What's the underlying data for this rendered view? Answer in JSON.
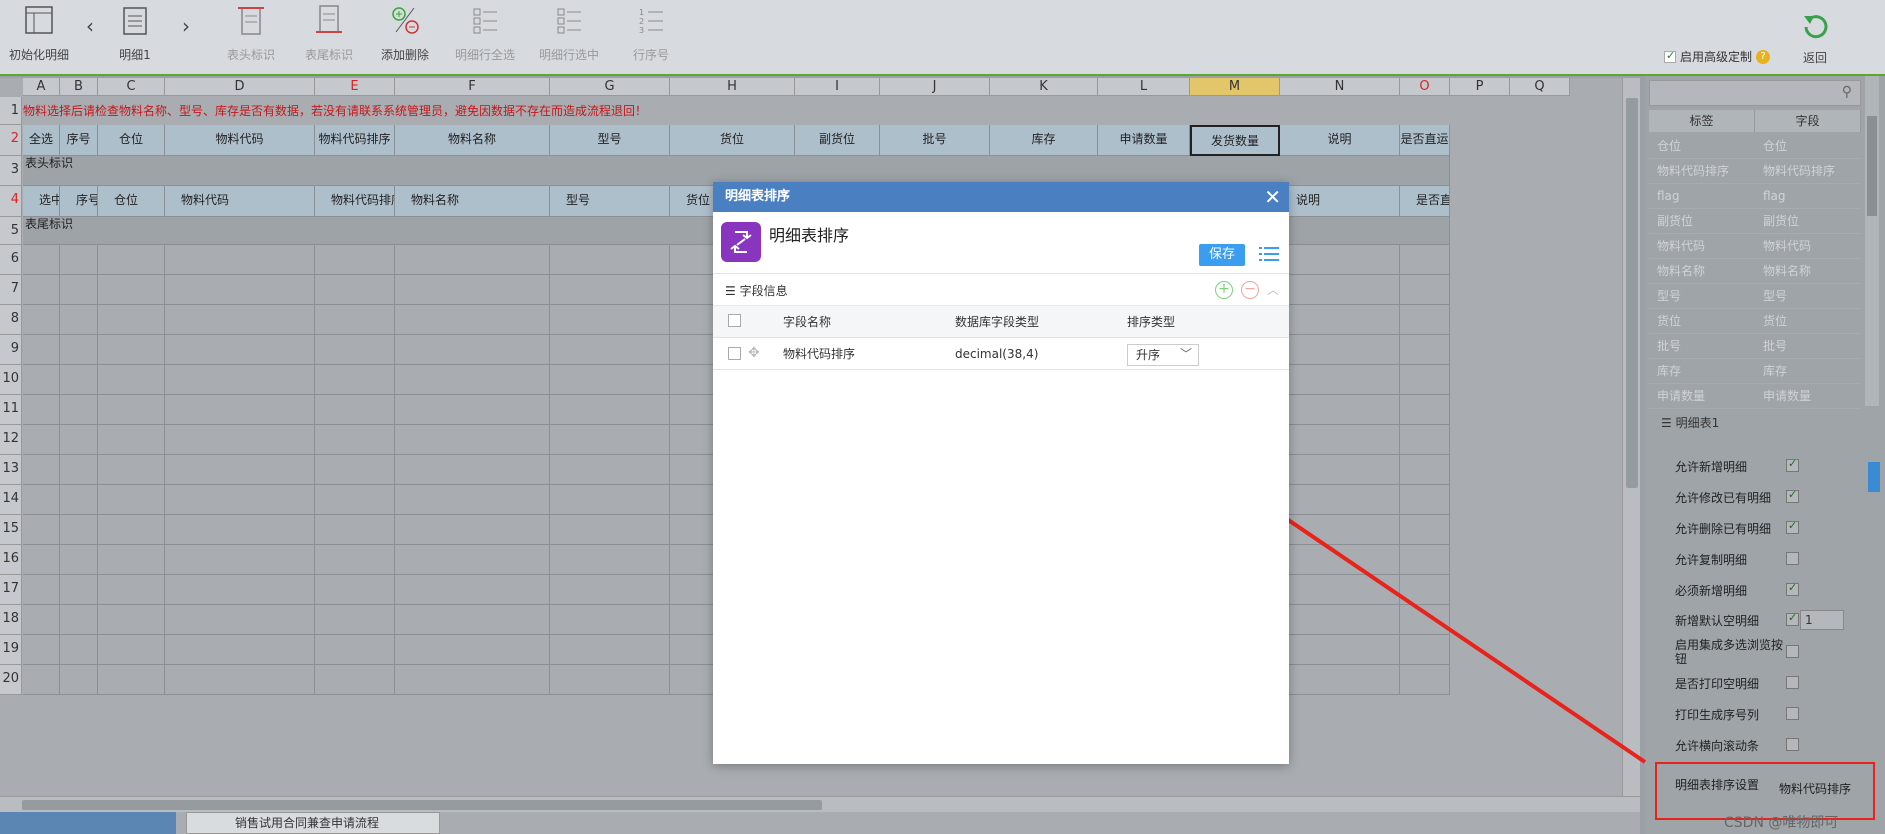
{
  "toolbar": {
    "init_label": "初始化明细",
    "prev_label": "‹",
    "detail_label": "明细1",
    "next_label": "›",
    "header_mark_label": "表头标识",
    "footer_mark_label": "表尾标识",
    "add_delete_label": "添加删除",
    "select_all_label": "明细行全选",
    "row_select_label": "明细行选中",
    "row_num_label": "行序号",
    "advanced_label": "启用高级定制",
    "return_label": "返回"
  },
  "sheet": {
    "columns": [
      "A",
      "B",
      "C",
      "D",
      "E",
      "F",
      "G",
      "H",
      "I",
      "J",
      "K",
      "L",
      "M",
      "N",
      "O",
      "P",
      "Q"
    ],
    "rows": [
      "1",
      "2",
      "3",
      "4",
      "5",
      "6",
      "7",
      "8",
      "9",
      "10",
      "11",
      "12",
      "13",
      "14",
      "15",
      "16",
      "17",
      "18",
      "19",
      "20"
    ],
    "notice": "物料选择后请检查物料名称、型号、库存是否有数据，若没有请联系系统管理员，避免因数据不存在而造成流程退回！",
    "row2": [
      "全选",
      "序号",
      "仓位",
      "物料代码",
      "物料代码排序",
      "物料名称",
      "型号",
      "货位",
      "副货位",
      "批号",
      "库存",
      "申请数量",
      "发货数量",
      "说明",
      "是否直运"
    ],
    "header_band": "表头标识",
    "row4": [
      "选中",
      "序号",
      "仓位",
      "物料代码",
      "物料代码排序",
      "物料名称",
      "型号",
      "货位",
      "",
      "",
      "",
      "",
      "",
      "说明",
      "是否直运"
    ],
    "footer_band": "表尾标识",
    "sheet_tab": "销售试用合同兼查申请流程"
  },
  "right_panel": {
    "col_label": "标签",
    "col_field": "字段",
    "rows": [
      [
        "仓位",
        "仓位"
      ],
      [
        "物料代码排序",
        "物料代码排序"
      ],
      [
        "flag",
        "flag"
      ],
      [
        "副货位",
        "副货位"
      ],
      [
        "物料代码",
        "物料代码"
      ],
      [
        "物料名称",
        "物料名称"
      ],
      [
        "型号",
        "型号"
      ],
      [
        "货位",
        "货位"
      ],
      [
        "批号",
        "批号"
      ],
      [
        "库存",
        "库存"
      ],
      [
        "申请数量",
        "申请数量"
      ]
    ],
    "section": "明细表1",
    "options": [
      {
        "label": "允许新增明细",
        "checked": true
      },
      {
        "label": "允许修改已有明细",
        "checked": true
      },
      {
        "label": "允许删除已有明细",
        "checked": true
      },
      {
        "label": "允许复制明细",
        "checked": false
      },
      {
        "label": "必须新增明细",
        "checked": true
      },
      {
        "label": "新增默认空明细",
        "checked": true
      },
      {
        "label": "启用集成多选浏览按钮",
        "checked": false
      },
      {
        "label": "是否打印空明细",
        "checked": false
      },
      {
        "label": "打印生成序号列",
        "checked": false
      },
      {
        "label": "允许横向滚动条",
        "checked": false
      }
    ],
    "default_empty_count": "1",
    "sort_setting_label": "明细表排序设置",
    "sort_setting_value": "物料代码排序"
  },
  "modal": {
    "title": "明细表排序",
    "name": "明细表排序",
    "save_label": "保存",
    "section_title": "字段信息",
    "headers": [
      "字段名称",
      "数据库字段类型",
      "排序类型"
    ],
    "rows": [
      {
        "field": "物料代码排序",
        "db_type": "decimal(38,4)",
        "sort": "升序"
      }
    ]
  },
  "watermark": "CSDN @唯物即可",
  "colors": {
    "accent": "#4a7fc1",
    "save": "#3a9df0",
    "arrow": "#e8231c",
    "notice": "#c6161b"
  }
}
